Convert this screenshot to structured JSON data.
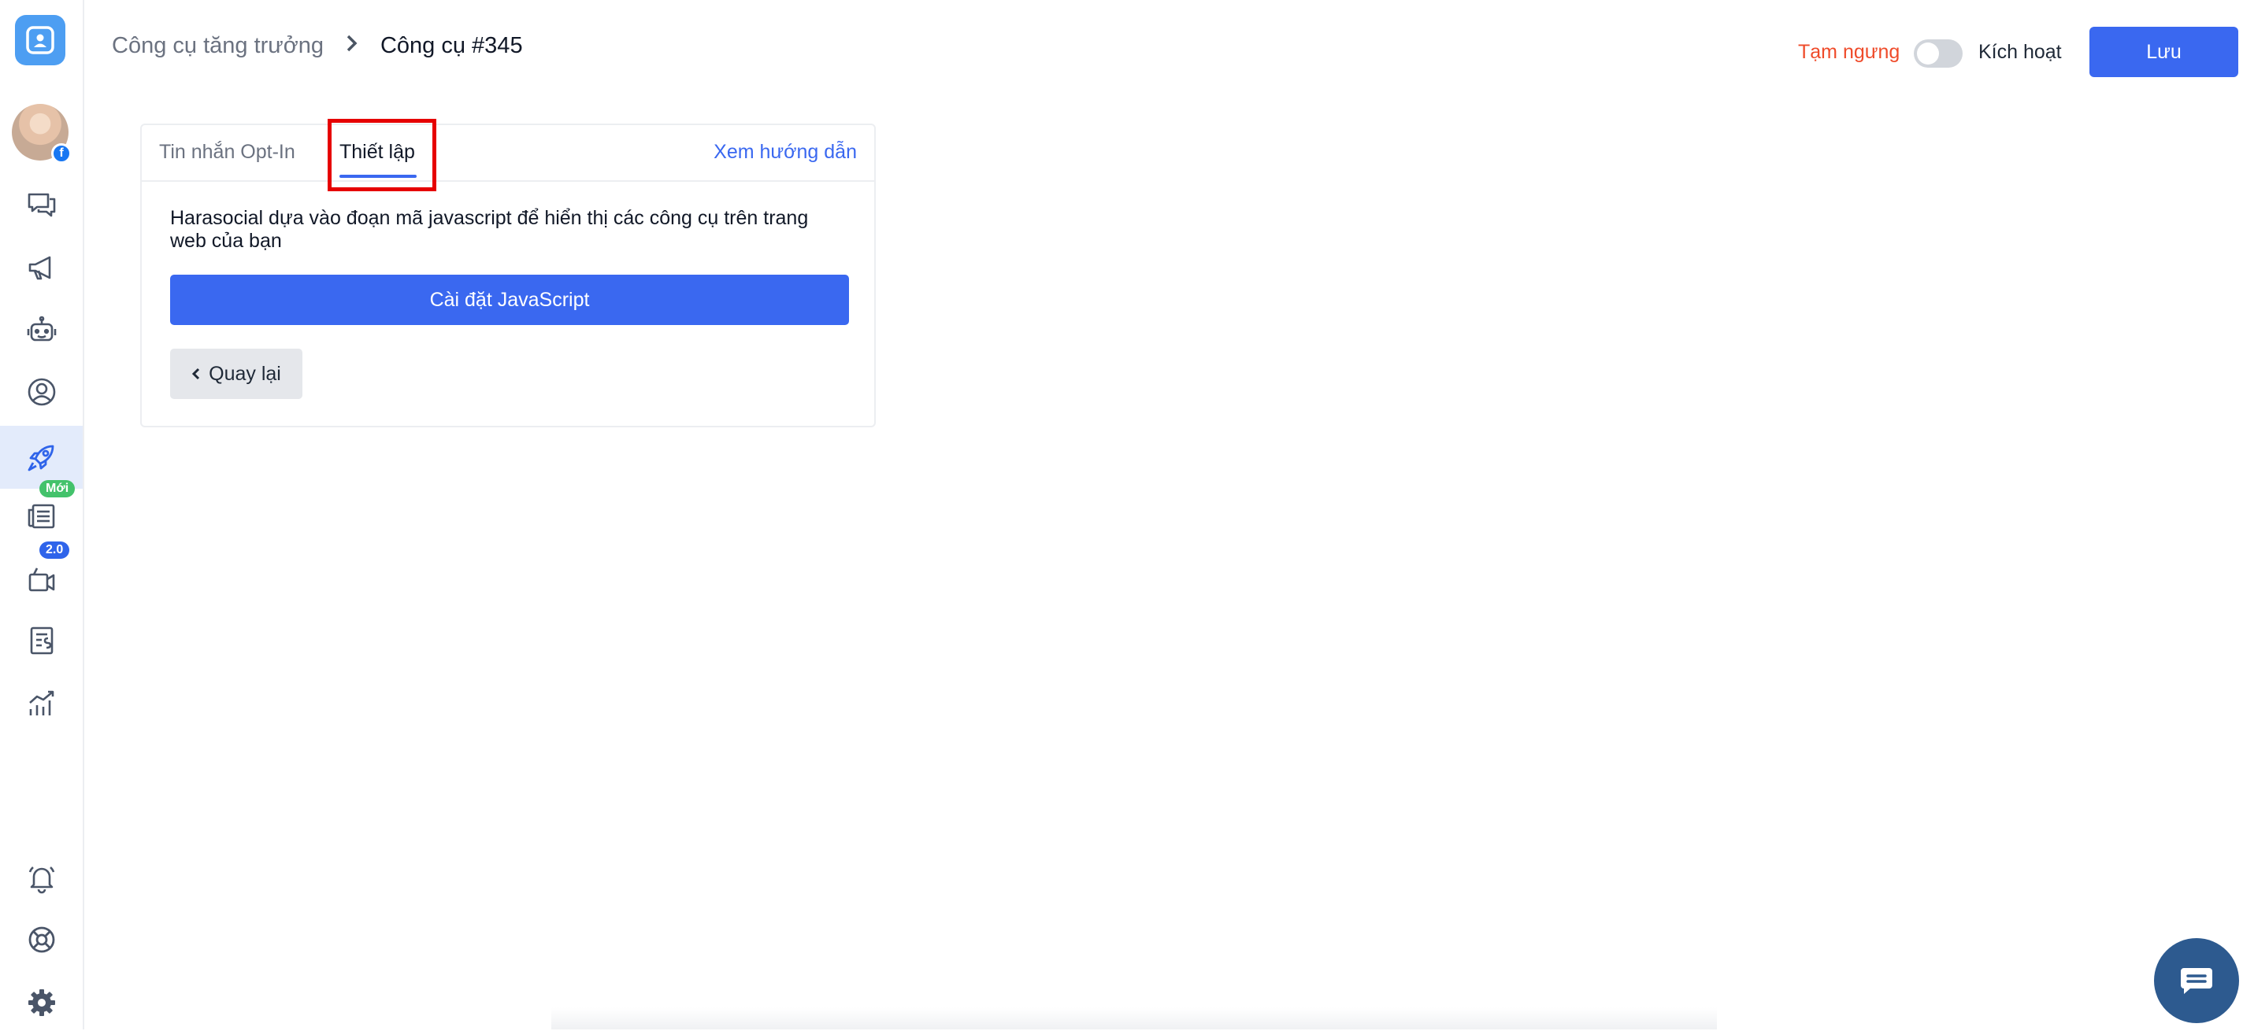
{
  "breadcrumb": {
    "parent": "Công cụ tăng trưởng",
    "separator": ">",
    "current": "Công cụ #345"
  },
  "header": {
    "status_off_label": "Tạm ngưng",
    "toggle_state": "off",
    "status_on_label": "Kích hoạt",
    "save_label": "Lưu"
  },
  "sidebar": {
    "items": [
      {
        "icon": "chat-bubbles-icon"
      },
      {
        "icon": "megaphone-icon"
      },
      {
        "icon": "robot-icon"
      },
      {
        "icon": "user-circle-icon"
      },
      {
        "icon": "rocket-icon",
        "active": true
      },
      {
        "icon": "newspaper-icon",
        "badge": "Mới"
      },
      {
        "icon": "broadcast-icon",
        "badge": "2.0"
      },
      {
        "icon": "invoice-icon"
      },
      {
        "icon": "chart-icon"
      }
    ],
    "bottom": [
      {
        "icon": "bell-icon"
      },
      {
        "icon": "lifebuoy-icon"
      },
      {
        "icon": "gear-icon"
      }
    ]
  },
  "card": {
    "tabs": [
      {
        "label": "Tin nhắn Opt-In",
        "active": false
      },
      {
        "label": "Thiết lập",
        "active": true
      }
    ],
    "guide_link": "Xem hướng dẫn",
    "description": "Harasocial dựa vào đoạn mã javascript để hiển thị các công cụ trên trang web của bạn",
    "install_button": "Cài đặt JavaScript",
    "back_button": "Quay lại"
  },
  "colors": {
    "primary": "#3a68f0",
    "danger": "#ef4b2a",
    "active_nav_bg": "#e3ebfb",
    "highlight": "#e60000"
  }
}
